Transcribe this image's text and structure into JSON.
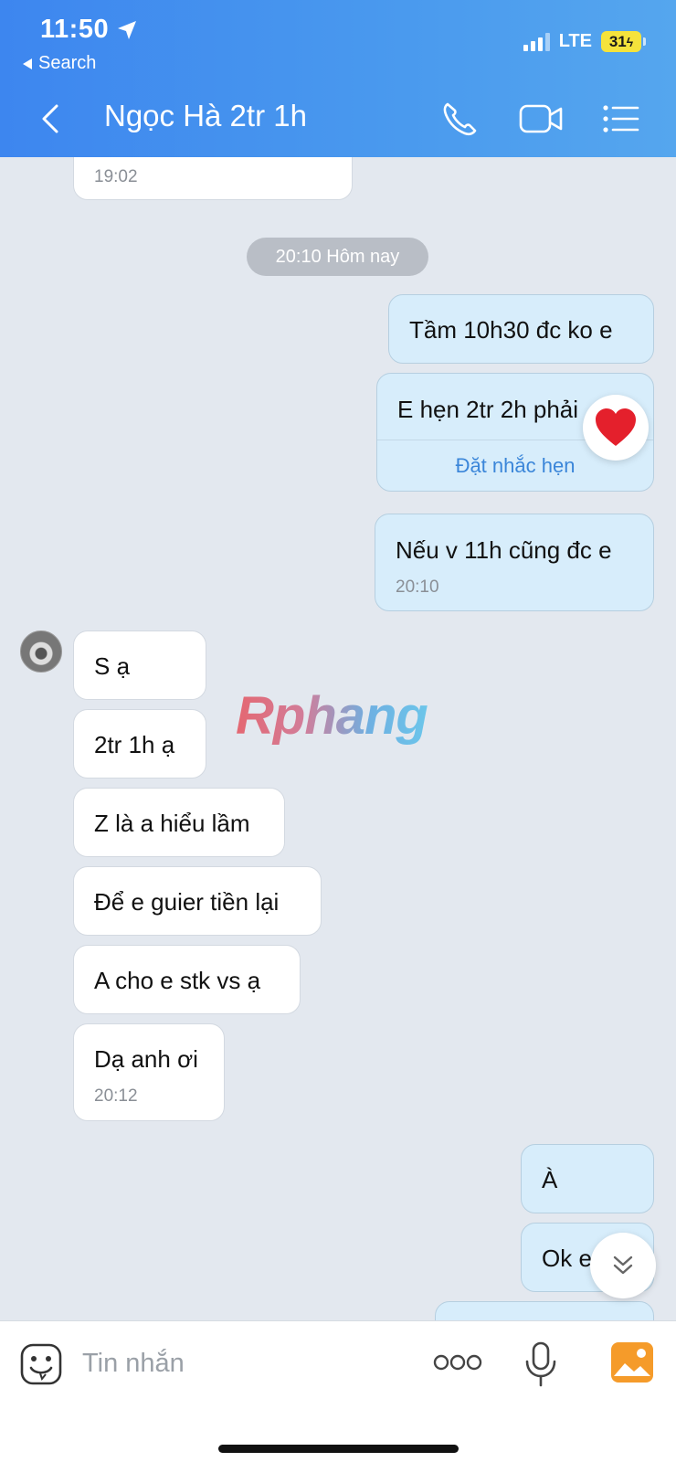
{
  "status_bar": {
    "time": "11:50",
    "back_app": "Search",
    "network": "LTE",
    "battery": "31"
  },
  "header": {
    "title": "Ngọc Hà 2tr 1h"
  },
  "messages": [
    {
      "dir": "in",
      "time": "19:02"
    },
    {
      "type": "date",
      "text": "20:10 Hôm nay"
    },
    {
      "dir": "out",
      "text": "Tầm 10h30 đc ko e"
    },
    {
      "dir": "out",
      "text": "E hẹn 2tr 2h phải",
      "action": "Đặt nhắc hẹn"
    },
    {
      "dir": "out",
      "text": "Nếu v 11h cũng đc e",
      "time": "20:10"
    },
    {
      "dir": "in",
      "text": "S ạ"
    },
    {
      "dir": "in",
      "text": "2tr 1h ạ"
    },
    {
      "dir": "in",
      "text": "Z là a hiểu lầm"
    },
    {
      "dir": "in",
      "text": "Để e guier tiền lại"
    },
    {
      "dir": "in",
      "text": "A cho e stk vs ạ"
    },
    {
      "dir": "in",
      "text": "Dạ anh ơi",
      "time": "20:12"
    },
    {
      "dir": "out",
      "text": "À"
    },
    {
      "dir": "out",
      "text": "Ok e"
    }
  ],
  "watermark": "Rphang",
  "composer": {
    "placeholder": "Tin nhắn"
  }
}
